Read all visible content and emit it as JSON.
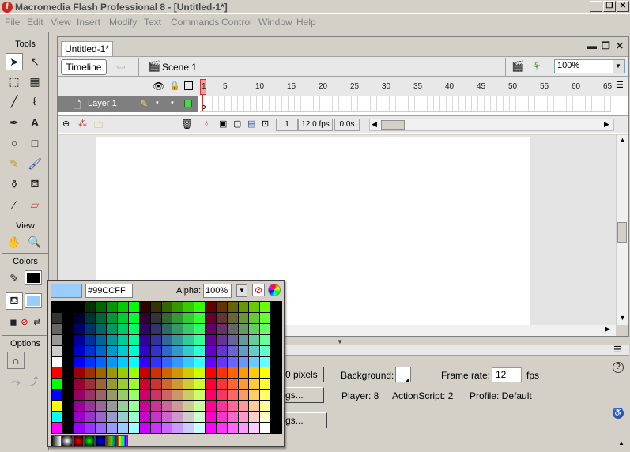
{
  "app": {
    "title": "Macromedia Flash Professional 8 - [Untitled-1*]"
  },
  "menu": [
    "File",
    "Edit",
    "View",
    "Insert",
    "Modify",
    "Text",
    "Commands",
    "Control",
    "Window",
    "Help"
  ],
  "tools": {
    "title": "Tools",
    "view_title": "View",
    "colors_title": "Colors",
    "options_title": "Options"
  },
  "document": {
    "tab": "Untitled-1*",
    "timeline_button": "Timeline",
    "scene": "Scene 1",
    "zoom": "100%"
  },
  "timeline": {
    "layer_name": "Layer 1",
    "ruler": [
      "1",
      "5",
      "10",
      "15",
      "20",
      "25",
      "30",
      "35",
      "40",
      "45",
      "50",
      "55",
      "60",
      "65"
    ],
    "current_frame": "1",
    "frame_rate": "12.0 fps",
    "elapsed": "0.0s"
  },
  "properties": {
    "size_button": "0 pixels",
    "background_label": "Background:",
    "frame_rate_label": "Frame rate:",
    "frame_rate_value": "12",
    "fps": "fps",
    "player": "Player: 8",
    "actionscript": "ActionScript:  2",
    "profile": "Profile:  Default",
    "settings_button": "gs...",
    "settings_button2": "gs..."
  },
  "color_popup": {
    "hex": "#99CCFF",
    "alpha_label": "Alpha:",
    "alpha_value": "100%",
    "preview_color": "#99ccff"
  }
}
